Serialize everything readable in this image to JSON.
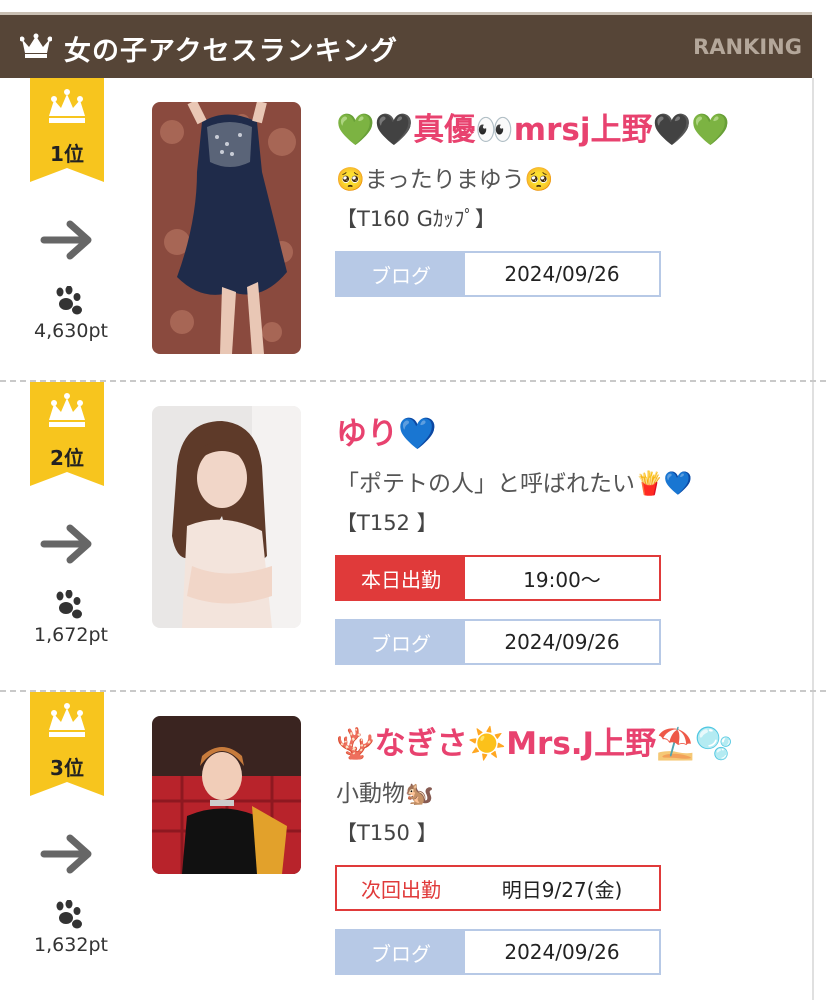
{
  "header": {
    "title": "女の子アクセスランキング",
    "en_label": "RANKING"
  },
  "entries": [
    {
      "rank": "1位",
      "points": "4,630pt",
      "name": "💚🖤真優👀mrsj上野🖤💚",
      "catch": "🥺まったりまゆう🥺",
      "spec": "【T160 Gｶｯﾌﾟ】",
      "blog_label": "ブログ",
      "blog_date": "2024/09/26"
    },
    {
      "rank": "2位",
      "points": "1,672pt",
      "name": "ゆり💙",
      "catch": "「ポテトの人」と呼ばれたい🍟💙",
      "spec": "【T152 】",
      "shift_label": "本日出勤",
      "shift_value": "19:00〜",
      "blog_label": "ブログ",
      "blog_date": "2024/09/26"
    },
    {
      "rank": "3位",
      "points": "1,632pt",
      "name": "🪸なぎさ☀️Mrs.J上野⛱️🫧",
      "catch": "小動物🐿️",
      "spec": "【T150 】",
      "shift_label": "次回出勤",
      "shift_value": "明日9/27(金)",
      "blog_label": "ブログ",
      "blog_date": "2024/09/26"
    }
  ],
  "icons": {
    "crown": "crown-icon",
    "arrow": "arrow-right-icon",
    "paw": "paw-icon"
  },
  "colors": {
    "header_bg": "#564537",
    "badge_gold": "#f7c51e",
    "name_pink": "#e8426f",
    "blog_blue": "#b7c9e6",
    "shift_red": "#e03a3a"
  }
}
